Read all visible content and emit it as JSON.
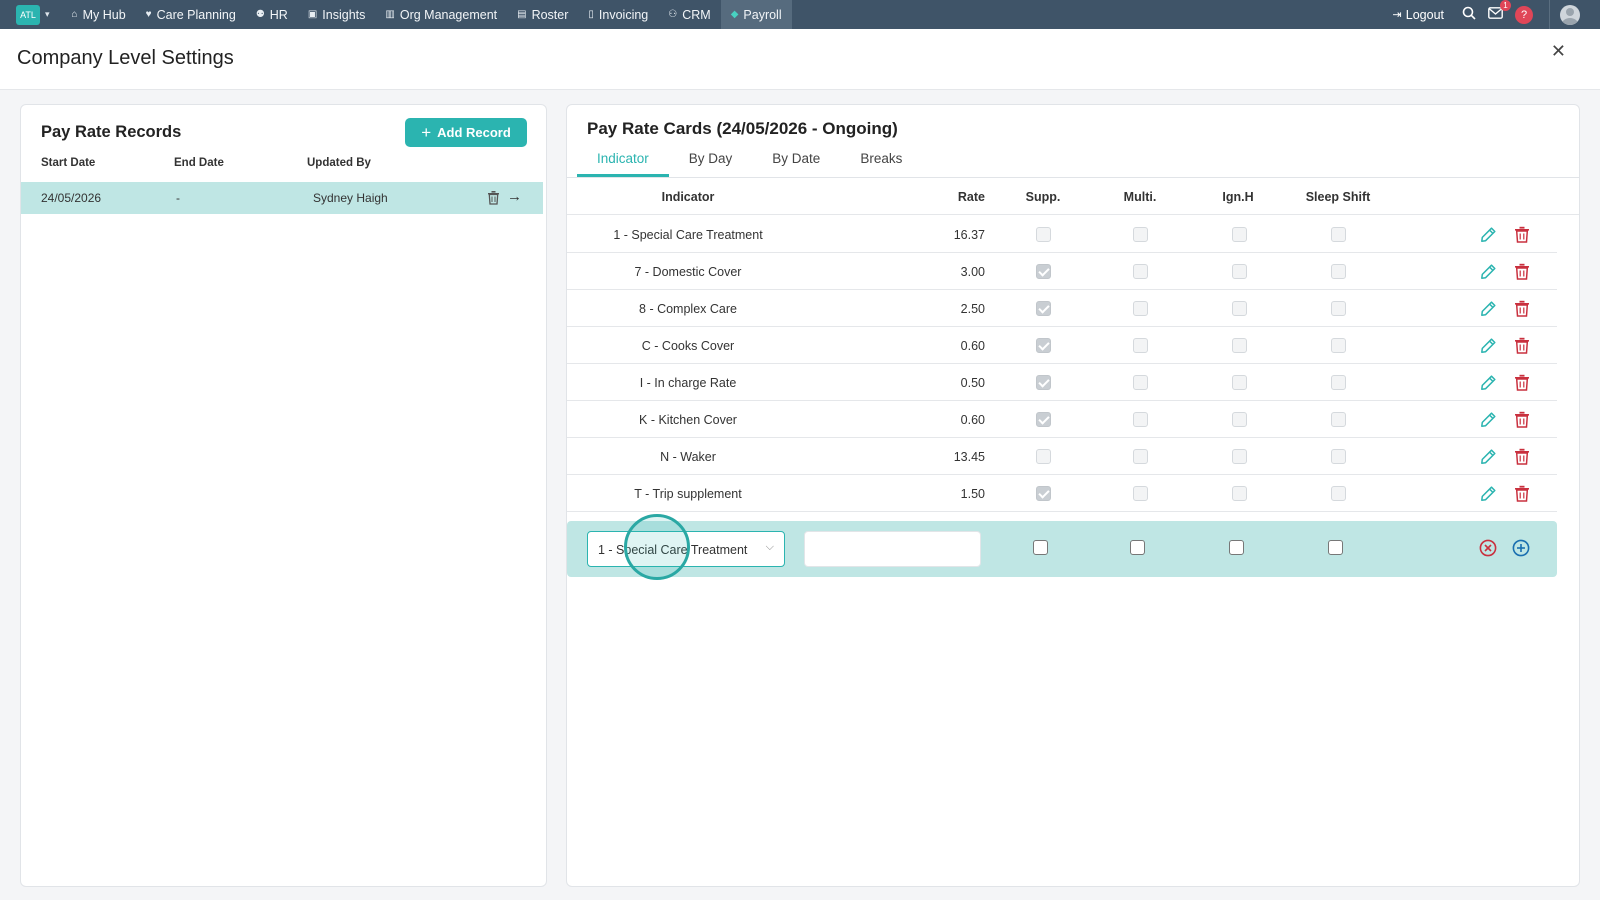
{
  "nav": {
    "brand_logo": "ATL",
    "items": [
      {
        "label": "My Hub",
        "icon": "home-icon"
      },
      {
        "label": "Care Planning",
        "icon": "heart-icon"
      },
      {
        "label": "HR",
        "icon": "people-icon"
      },
      {
        "label": "Insights",
        "icon": "chart-icon"
      },
      {
        "label": "Org Management",
        "icon": "building-icon"
      },
      {
        "label": "Roster",
        "icon": "calendar-icon"
      },
      {
        "label": "Invoicing",
        "icon": "document-icon"
      },
      {
        "label": "CRM",
        "icon": "contacts-icon"
      },
      {
        "label": "Payroll",
        "icon": "payroll-icon",
        "active": true
      }
    ],
    "logout_label": "Logout",
    "mail_badge": "1",
    "help_label": "?"
  },
  "page": {
    "title": "Company Level Settings"
  },
  "records": {
    "title": "Pay Rate Records",
    "add_label": "Add Record",
    "columns": [
      "Start Date",
      "End Date",
      "Updated By"
    ],
    "rows": [
      {
        "start": "24/05/2026",
        "end": "-",
        "updated_by": "Sydney Haigh"
      }
    ]
  },
  "cards": {
    "title": "Pay Rate Cards (24/05/2026 - Ongoing)",
    "tabs": [
      "Indicator",
      "By Day",
      "By Date",
      "Breaks"
    ],
    "active_tab": "Indicator",
    "columns": [
      "Indicator",
      "Rate",
      "Supp.",
      "Multi.",
      "Ign.H",
      "Sleep Shift"
    ],
    "rows": [
      {
        "indicator": "1 - Special Care Treatment",
        "rate": "16.37",
        "supp": false,
        "multi": false,
        "ign": false,
        "sleep": false
      },
      {
        "indicator": "7 - Domestic Cover",
        "rate": "3.00",
        "supp": true,
        "multi": false,
        "ign": false,
        "sleep": false
      },
      {
        "indicator": "8 - Complex Care",
        "rate": "2.50",
        "supp": true,
        "multi": false,
        "ign": false,
        "sleep": false
      },
      {
        "indicator": "C - Cooks Cover",
        "rate": "0.60",
        "supp": true,
        "multi": false,
        "ign": false,
        "sleep": false
      },
      {
        "indicator": "I - In charge Rate",
        "rate": "0.50",
        "supp": true,
        "multi": false,
        "ign": false,
        "sleep": false
      },
      {
        "indicator": "K - Kitchen Cover",
        "rate": "0.60",
        "supp": true,
        "multi": false,
        "ign": false,
        "sleep": false
      },
      {
        "indicator": "N - Waker",
        "rate": "13.45",
        "supp": false,
        "multi": false,
        "ign": false,
        "sleep": false
      },
      {
        "indicator": "T - Trip supplement",
        "rate": "1.50",
        "supp": true,
        "multi": false,
        "ign": false,
        "sleep": false
      }
    ],
    "new_row": {
      "selected_indicator": "1 - Special Care Treatment",
      "rate_value": ""
    }
  },
  "colors": {
    "accent": "#2bb4b0",
    "nav_bg": "#3f5468",
    "selected_row": "#bfe6e4",
    "edit_icon": "#2bb4b0",
    "delete_icon": "#c9303e"
  }
}
